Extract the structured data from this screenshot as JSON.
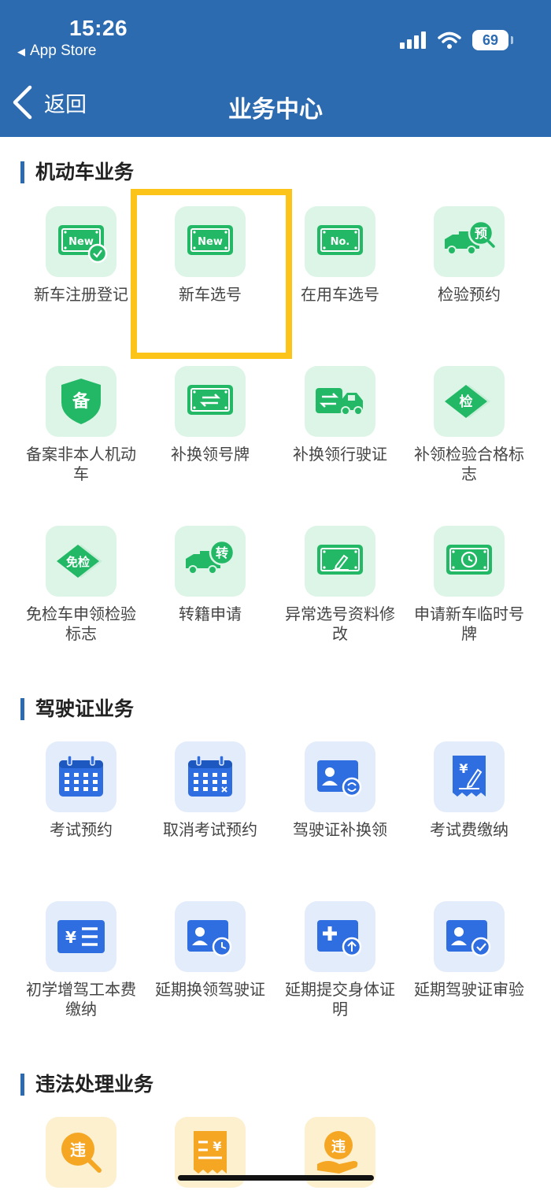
{
  "status_bar": {
    "time": "15:26",
    "back_app": "App Store",
    "battery": "69"
  },
  "nav": {
    "back_label": "返回",
    "title": "业务中心"
  },
  "colors": {
    "header_bg": "#2d6bb0",
    "green_icon": "#22b866",
    "blue_icon": "#2f6ee0",
    "orange_icon": "#f5a623",
    "highlight": "#fcc419"
  },
  "sections": [
    {
      "title": "机动车业务",
      "items": [
        {
          "label": "新车注册登记",
          "icon": "new-plate-check-icon"
        },
        {
          "label": "新车选号",
          "icon": "new-plate-icon"
        },
        {
          "label": "在用车选号",
          "icon": "no-plate-icon"
        },
        {
          "label": "检验预约",
          "icon": "truck-reserve-icon"
        },
        {
          "label": "备案非本人机动车",
          "icon": "shield-record-icon"
        },
        {
          "label": "补换领号牌",
          "icon": "plate-exchange-icon"
        },
        {
          "label": "补换领行驶证",
          "icon": "car-exchange-icon"
        },
        {
          "label": "补领检验合格标志",
          "icon": "inspection-diamond-icon"
        },
        {
          "label": "免检车申领检验标志",
          "icon": "exempt-diamond-icon"
        },
        {
          "label": "转籍申请",
          "icon": "truck-transfer-icon"
        },
        {
          "label": "异常选号资料修改",
          "icon": "plate-edit-icon"
        },
        {
          "label": "申请新车临时号牌",
          "icon": "plate-clock-icon"
        }
      ]
    },
    {
      "title": "驾驶证业务",
      "items": [
        {
          "label": "考试预约",
          "icon": "calendar-icon"
        },
        {
          "label": "取消考试预约",
          "icon": "calendar-cancel-icon"
        },
        {
          "label": "驾驶证补换领",
          "icon": "license-exchange-icon"
        },
        {
          "label": "考试费缴纳",
          "icon": "receipt-fee-icon"
        },
        {
          "label": "初学增驾工本费缴纳",
          "icon": "fee-list-icon"
        },
        {
          "label": "延期换领驾驶证",
          "icon": "license-clock-icon"
        },
        {
          "label": "延期提交身体证明",
          "icon": "medical-upload-icon"
        },
        {
          "label": "延期驾驶证审验",
          "icon": "license-check-icon"
        }
      ]
    },
    {
      "title": "违法处理业务",
      "items": [
        {
          "label": "",
          "icon": "violation-search-icon"
        },
        {
          "label": "",
          "icon": "fine-receipt-icon"
        },
        {
          "label": "",
          "icon": "violation-hand-icon"
        }
      ]
    }
  ],
  "icon_text": {
    "new": "New",
    "no": "No.",
    "reserve": "预",
    "record": "备",
    "inspect": "检",
    "exempt": "免检",
    "transfer": "转",
    "violation": "违",
    "yen": "¥"
  }
}
